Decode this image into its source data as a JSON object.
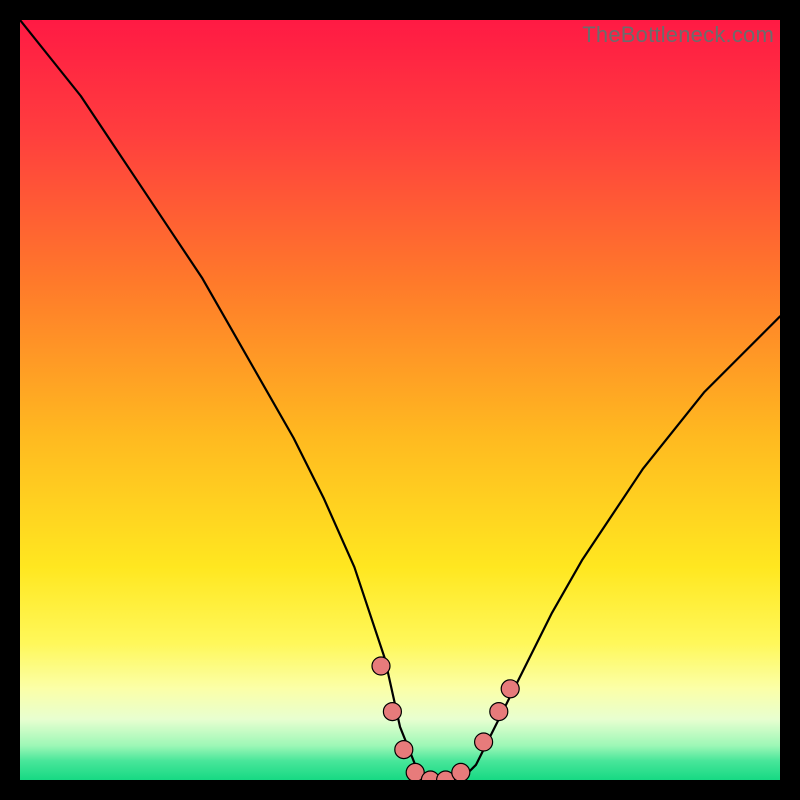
{
  "watermark": {
    "text": "TheBottleneck.com"
  },
  "colors": {
    "frame": "#000000",
    "curve": "#000000",
    "marker_fill": "#e77b7b",
    "marker_stroke": "#000000",
    "gradient_stops": [
      {
        "offset": 0.0,
        "color": "#ff1a44"
      },
      {
        "offset": 0.15,
        "color": "#ff3e3e"
      },
      {
        "offset": 0.35,
        "color": "#ff7b2a"
      },
      {
        "offset": 0.55,
        "color": "#ffba20"
      },
      {
        "offset": 0.72,
        "color": "#ffe720"
      },
      {
        "offset": 0.82,
        "color": "#fff85a"
      },
      {
        "offset": 0.88,
        "color": "#fbffa8"
      },
      {
        "offset": 0.92,
        "color": "#e8ffd0"
      },
      {
        "offset": 0.955,
        "color": "#9cf7b6"
      },
      {
        "offset": 0.975,
        "color": "#48e69a"
      },
      {
        "offset": 1.0,
        "color": "#16d983"
      }
    ]
  },
  "chart_data": {
    "type": "line",
    "title": "",
    "xlabel": "",
    "ylabel": "",
    "xlim": [
      0,
      100
    ],
    "ylim": [
      0,
      100
    ],
    "series": [
      {
        "name": "bottleneck-curve",
        "x": [
          0,
          4,
          8,
          12,
          16,
          20,
          24,
          28,
          32,
          36,
          40,
          44,
          48,
          50,
          52,
          54,
          56,
          58,
          60,
          62,
          66,
          70,
          74,
          78,
          82,
          86,
          90,
          94,
          98,
          100
        ],
        "y": [
          100,
          95,
          90,
          84,
          78,
          72,
          66,
          59,
          52,
          45,
          37,
          28,
          16,
          7,
          2,
          0,
          0,
          0,
          2,
          6,
          14,
          22,
          29,
          35,
          41,
          46,
          51,
          55,
          59,
          61
        ]
      }
    ],
    "markers": {
      "name": "highlight-dots",
      "points": [
        {
          "x": 47.5,
          "y": 15
        },
        {
          "x": 49.0,
          "y": 9
        },
        {
          "x": 50.5,
          "y": 4
        },
        {
          "x": 52.0,
          "y": 1
        },
        {
          "x": 54.0,
          "y": 0
        },
        {
          "x": 56.0,
          "y": 0
        },
        {
          "x": 58.0,
          "y": 1
        },
        {
          "x": 61.0,
          "y": 5
        },
        {
          "x": 63.0,
          "y": 9
        },
        {
          "x": 64.5,
          "y": 12
        }
      ],
      "radius": 9
    }
  }
}
